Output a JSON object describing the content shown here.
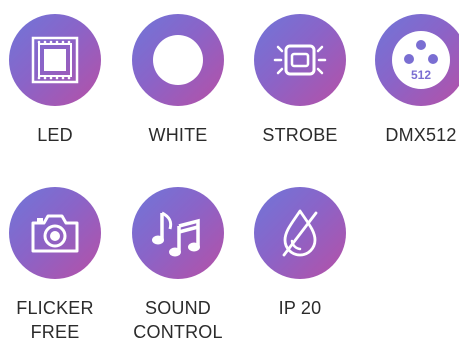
{
  "features": [
    {
      "label": "LED",
      "icon": "led-panel-icon"
    },
    {
      "label": "WHITE",
      "icon": "white-circle-icon"
    },
    {
      "label": "STROBE",
      "icon": "strobe-icon"
    },
    {
      "label": "DMX512",
      "icon": "dmx-connector-icon",
      "badge": "512"
    },
    {
      "label": "FLICKER\nFREE",
      "icon": "camera-icon"
    },
    {
      "label": "SOUND\nCONTROL",
      "icon": "music-notes-icon"
    },
    {
      "label": "IP 20",
      "icon": "water-drop-crossed-icon"
    }
  ],
  "colors": {
    "gradient_start": "#6f76d9",
    "gradient_mid": "#8a64c8",
    "gradient_end": "#b650a6",
    "label_text": "#2b2b2b",
    "icon": "#ffffff"
  }
}
